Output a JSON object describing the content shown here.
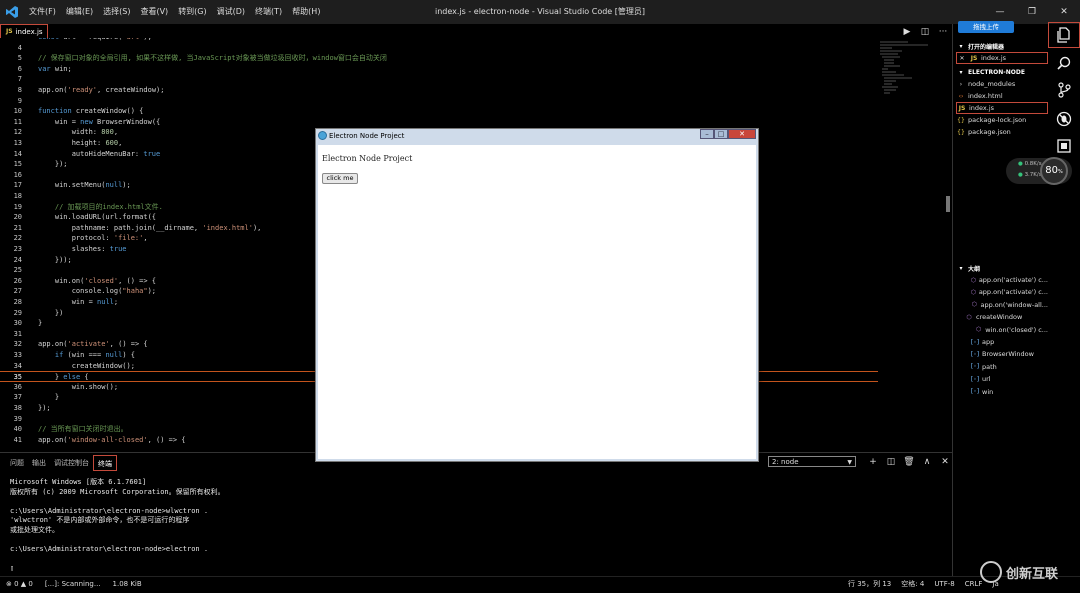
{
  "titlebar": {
    "title": "index.js - electron-node - Visual Studio Code [管理员]",
    "menu": [
      "文件(F)",
      "编辑(E)",
      "选择(S)",
      "查看(V)",
      "转到(G)",
      "调试(D)",
      "终端(T)",
      "帮助(H)"
    ],
    "controls": [
      "—",
      "❐",
      "✕"
    ]
  },
  "tab": {
    "icon": "JS",
    "label": "index.js"
  },
  "editor": {
    "lines": [
      {
        "n": "",
        "code": "const url = require('url');"
      },
      {
        "n": "4",
        "code": ""
      },
      {
        "n": "5",
        "code": "// 保存窗口对象的全局引用, 如果不这样做, 当JavaScript对象被当做垃圾回收时，window窗口会自动关闭"
      },
      {
        "n": "6",
        "code": "var win;"
      },
      {
        "n": "7",
        "code": ""
      },
      {
        "n": "8",
        "code": "app.on('ready', createWindow);"
      },
      {
        "n": "9",
        "code": ""
      },
      {
        "n": "10",
        "code": "function createWindow() {"
      },
      {
        "n": "11",
        "code": "    win = new BrowserWindow({"
      },
      {
        "n": "12",
        "code": "        width: 800,"
      },
      {
        "n": "13",
        "code": "        height: 600,"
      },
      {
        "n": "14",
        "code": "        autoHideMenuBar: true"
      },
      {
        "n": "15",
        "code": "    });"
      },
      {
        "n": "16",
        "code": ""
      },
      {
        "n": "17",
        "code": "    win.setMenu(null);"
      },
      {
        "n": "18",
        "code": ""
      },
      {
        "n": "19",
        "code": "    // 加载项目的index.html文件."
      },
      {
        "n": "20",
        "code": "    win.loadURL(url.format({"
      },
      {
        "n": "21",
        "code": "        pathname: path.join(__dirname, 'index.html'),"
      },
      {
        "n": "22",
        "code": "        protocol: 'file:',"
      },
      {
        "n": "23",
        "code": "        slashes: true"
      },
      {
        "n": "24",
        "code": "    }));"
      },
      {
        "n": "25",
        "code": ""
      },
      {
        "n": "26",
        "code": "    win.on('closed', () => {"
      },
      {
        "n": "27",
        "code": "        console.log(\"haha\");"
      },
      {
        "n": "28",
        "code": "        win = null;"
      },
      {
        "n": "29",
        "code": "    })"
      },
      {
        "n": "30",
        "code": "}"
      },
      {
        "n": "31",
        "code": ""
      },
      {
        "n": "32",
        "code": "app.on('activate', () => {"
      },
      {
        "n": "33",
        "code": "    if (win === null) {"
      },
      {
        "n": "34",
        "code": "        createWindow();"
      },
      {
        "n": "35",
        "code": "    } else {"
      },
      {
        "n": "36",
        "code": "        win.show();"
      },
      {
        "n": "37",
        "code": "    }"
      },
      {
        "n": "38",
        "code": "});"
      },
      {
        "n": "39",
        "code": ""
      },
      {
        "n": "40",
        "code": "// 当所有窗口关闭时退出。"
      },
      {
        "n": "41",
        "code": "app.on('window-all-closed', () => {"
      }
    ],
    "current_line": "35"
  },
  "panel": {
    "tabs": [
      "问题",
      "输出",
      "调试控制台",
      "终端"
    ],
    "active_tab": "终端",
    "terminal_select": "2: node",
    "terminal_lines": [
      "Microsoft Windows [版本 6.1.7601]",
      "版权所有 (c) 2009 Microsoft Corporation。保留所有权利。",
      "",
      "c:\\Users\\Administrator\\electron-node>wlwctron .",
      "'wlwctron' 不是内部或外部命令，也不是可运行的程序",
      "或批处理文件。",
      "",
      "c:\\Users\\Administrator\\electron-node>electron .",
      "",
      "▯"
    ]
  },
  "statusbar": {
    "errors": "⊗ 0 ▲ 0",
    "scanning": "[...]: Scanning...",
    "size": "1.08 KiB",
    "position": "行 35，列 13",
    "spaces": "空格: 4",
    "encoding": "UTF-8",
    "eol": "CRLF",
    "lang": "Ja"
  },
  "sidebar": {
    "upload_button": "拖拽上传",
    "open_editors_title": "打开的编辑器",
    "open_editor": "index.js",
    "project_title": "ELECTRON-NODE",
    "files": [
      "node_modules",
      "index.html",
      "index.js",
      "package-lock.json",
      "package.json"
    ],
    "outline_title": "大纲",
    "outline": [
      "app.on('activate') c...",
      "app.on('activate') c...",
      "app.on('window-all...",
      "createWindow",
      "win.on('closed') c...",
      "app",
      "BrowserWindow",
      "path",
      "url",
      "win"
    ]
  },
  "speed": {
    "up": "0.8K/s",
    "down": "3.7K/s",
    "percent": "80"
  },
  "appwindow": {
    "title": "Electron Node Project",
    "heading": "Electron Node Project",
    "button": "click me"
  },
  "watermark": {
    "text": "创新互联"
  }
}
